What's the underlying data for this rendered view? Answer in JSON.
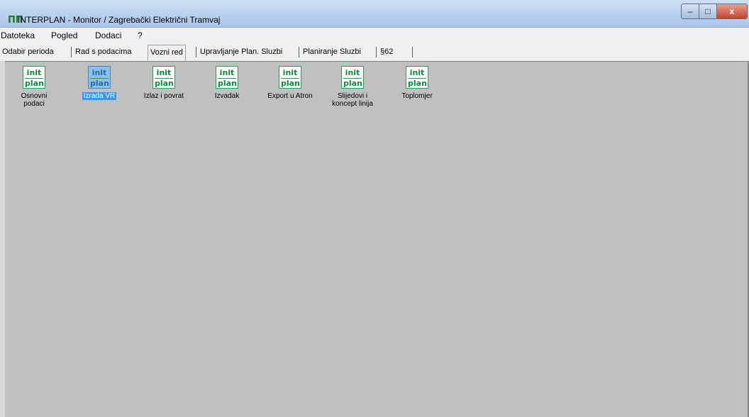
{
  "window": {
    "title": "INTERPLAN - Monitor / Zagrebački Električni Tramvaj",
    "app_icon": "ΠΠ",
    "controls": {
      "minimize": "–",
      "maximize": "□",
      "close": "x"
    }
  },
  "menu": [
    "Datoteka",
    "Pogled",
    "Dodaci",
    "?"
  ],
  "tabs": [
    {
      "label": "Odabir perioda"
    },
    {
      "label": "Rad s podacima"
    },
    {
      "label": "Vozni red",
      "active": true
    },
    {
      "label": "Upravljanje Plan. Sluzbi"
    },
    {
      "label": "Planiranje Sluzbi"
    },
    {
      "label": "§62"
    }
  ],
  "logo": {
    "top": "init",
    "bottom": "plan"
  },
  "modules": [
    {
      "label": "Osnovni podaci"
    },
    {
      "label": "Izrada VR",
      "selected": true
    },
    {
      "label": "Izlaz i povrat"
    },
    {
      "label": "Izvadak"
    },
    {
      "label": "Export u Atron"
    },
    {
      "label": "Slijedovi i koncept linija"
    },
    {
      "label": "Toplomjer"
    }
  ]
}
